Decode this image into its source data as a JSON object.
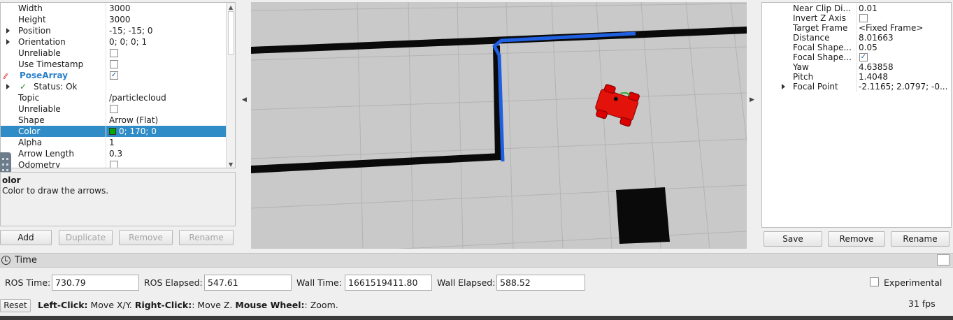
{
  "displays": {
    "rows": [
      {
        "name": "Width",
        "value": "3000"
      },
      {
        "name": "Height",
        "value": "3000"
      },
      {
        "name": "Position",
        "value": "-15; -15; 0",
        "expandable": true
      },
      {
        "name": "Orientation",
        "value": "0; 0; 0; 1",
        "expandable": true
      },
      {
        "name": "Unreliable",
        "value": "",
        "checkbox": false
      },
      {
        "name": "Use Timestamp",
        "value": "",
        "checkbox": false
      },
      {
        "name": "PoseArray",
        "value": "",
        "checkbox": true,
        "header": true
      },
      {
        "name": "Status: Ok",
        "value": "",
        "expandable": true,
        "status": true
      },
      {
        "name": "Topic",
        "value": "/particlecloud"
      },
      {
        "name": "Unreliable",
        "value": "",
        "checkbox": false
      },
      {
        "name": "Shape",
        "value": "Arrow (Flat)"
      },
      {
        "name": "Color",
        "value": "0; 170; 0",
        "selected": true,
        "swatch": "#00aa00"
      },
      {
        "name": "Alpha",
        "value": "1"
      },
      {
        "name": "Arrow Length",
        "value": "0.3"
      },
      {
        "name": "Odometry",
        "value": "",
        "checkbox": false
      }
    ],
    "description_title": "Color",
    "description_title_visible": "olor",
    "description_text": "Color to draw the arrows.",
    "buttons": {
      "add": "Add",
      "duplicate": "Duplicate",
      "remove": "Remove",
      "rename": "Rename"
    }
  },
  "views": {
    "rows": [
      {
        "name": "Near Clip Di...",
        "value": "0.01"
      },
      {
        "name": "Invert Z Axis",
        "value": "",
        "checkbox": false
      },
      {
        "name": "Target Frame",
        "value": "<Fixed Frame>"
      },
      {
        "name": "Distance",
        "value": "8.01663"
      },
      {
        "name": "Focal Shape...",
        "value": "0.05"
      },
      {
        "name": "Focal Shape...",
        "value": "",
        "checkbox": true
      },
      {
        "name": "Yaw",
        "value": "4.63858"
      },
      {
        "name": "Pitch",
        "value": "1.4048"
      },
      {
        "name": "Focal Point",
        "value": "-2.1165; 2.0797; -0...",
        "expandable": true
      }
    ],
    "buttons": {
      "save": "Save",
      "remove": "Remove",
      "rename": "Rename"
    }
  },
  "time": {
    "title": "Time",
    "ros_time_label": "ROS Time:",
    "ros_time": "730.79",
    "ros_elapsed_label": "ROS Elapsed:",
    "ros_elapsed": "547.61",
    "wall_time_label": "Wall Time:",
    "wall_time": "1661519411.80",
    "wall_elapsed_label": "Wall Elapsed:",
    "wall_elapsed": "588.52",
    "experimental_label": "Experimental"
  },
  "status": {
    "reset": "Reset",
    "left_click": "Left-Click:",
    "left_click_text": " Move X/Y. ",
    "right_click": "Right-Click:",
    "right_click_text": ": Move Z. ",
    "wheel": "Mouse Wheel:",
    "wheel_text": ": Zoom.",
    "fps": "31 fps"
  },
  "colors": {
    "selection": "#308cc6",
    "path": "#1f5fe0",
    "robot": "#e3120b",
    "particles": "#00aa00"
  }
}
